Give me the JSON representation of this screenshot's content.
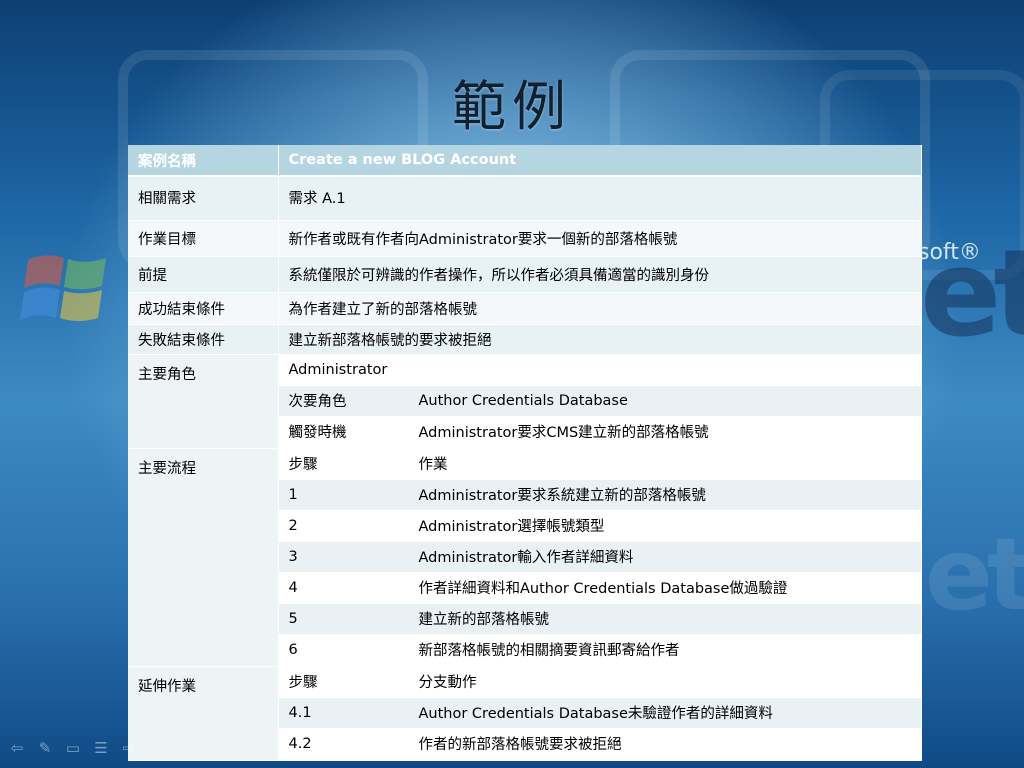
{
  "slide": {
    "title": "範例",
    "background_colors": {
      "top": "#0d3f73",
      "mid": "#3d8ac2",
      "glow": "#bee1f5"
    }
  },
  "table": {
    "header": {
      "label": "案例名稱",
      "value": "Create a new BLOG Account"
    },
    "rows": [
      {
        "label": "相關需求",
        "value": "需求 A.1"
      },
      {
        "label": "作業目標",
        "value": "新作者或既有作者向Administrator要求一個新的部落格帳號"
      },
      {
        "label": "前提",
        "value": "系統僅限於可辨識的作者操作，所以作者必須具備適當的識別身份"
      },
      {
        "label": "成功結束條件",
        "value": "為作者建立了新的部落格帳號"
      },
      {
        "label": "失敗結束條件",
        "value": "建立新部落格帳號的要求被拒絕"
      }
    ],
    "actor_section": {
      "label": "主要角色",
      "primary_actor": "Administrator",
      "rows": [
        {
          "k": "次要角色",
          "v": "Author Credentials Database"
        },
        {
          "k": "觸發時機",
          "v": "Administrator要求CMS建立新的部落格帳號"
        }
      ]
    },
    "main_flow": {
      "label": "主要流程",
      "col_step": "步驟",
      "col_action": "作業",
      "steps": [
        {
          "step": "1",
          "action": "Administrator要求系統建立新的部落格帳號"
        },
        {
          "step": "2",
          "action": "Administrator選擇帳號類型"
        },
        {
          "step": "3",
          "action": "Administrator輸入作者詳細資料"
        },
        {
          "step": "4",
          "action": "作者詳細資料和Author Credentials Database做過驗證"
        },
        {
          "step": "5",
          "action": "建立新的部落格帳號"
        },
        {
          "step": "6",
          "action": "新部落格帳號的相關摘要資訊郵寄給作者"
        }
      ]
    },
    "extensions": {
      "label": "延伸作業",
      "col_step": "步驟",
      "col_action": "分支動作",
      "steps": [
        {
          "step": "4.1",
          "action": "Author Credentials Database未驗證作者的詳細資料"
        },
        {
          "step": "4.2",
          "action": "作者的新部落格帳號要求被拒絕"
        }
      ]
    }
  },
  "background_text": {
    "soft": "soft®",
    "big": "et"
  },
  "nav_icons": [
    "arrow-left-icon",
    "pen-icon",
    "eraser-icon",
    "menu-icon",
    "arrow-right-icon"
  ]
}
